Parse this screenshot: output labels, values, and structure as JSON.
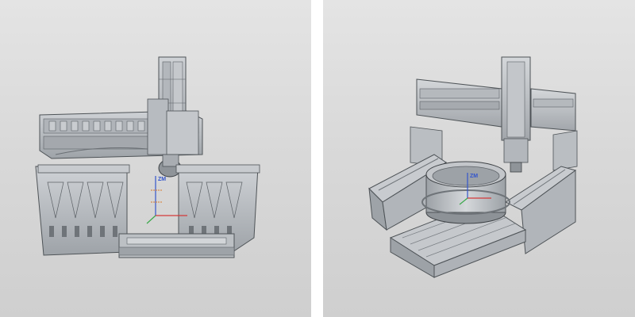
{
  "panels": [
    {
      "id": "left",
      "content": "gantry-machine-cad-render",
      "axis_indicator": {
        "label": "ZM",
        "color": "#3355cc"
      }
    },
    {
      "id": "right",
      "content": "gantry-machine-with-rotary-ring-cad-render",
      "axis_indicator": {
        "label": "ZM",
        "color": "#3355cc"
      }
    }
  ],
  "colors": {
    "background": "#d9d9d9",
    "divider": "#ffffff",
    "metal_light": "#c8cbcf",
    "metal_mid": "#a9adb2",
    "metal_dark": "#6f7479",
    "axis_x": "#d43a3a",
    "axis_y": "#3aa84a",
    "axis_z": "#3355cc",
    "marker": "#d97a2b"
  }
}
